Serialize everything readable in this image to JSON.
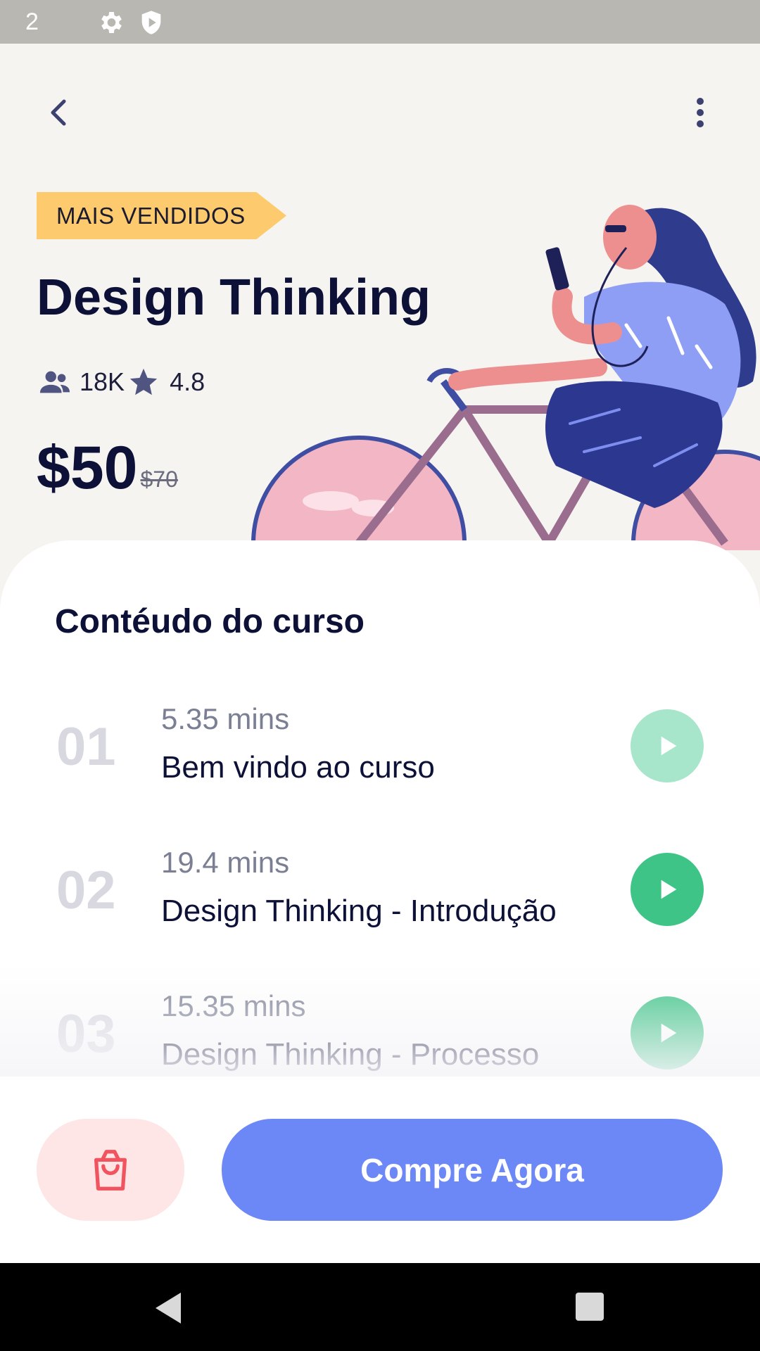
{
  "status_bar": {
    "time": "2",
    "icons": [
      "gear-icon",
      "shield-icon"
    ]
  },
  "header": {
    "back_icon": "chevron-left-icon",
    "menu_icon": "more-vertical-icon"
  },
  "course": {
    "badge": "MAIS VENDIDOS",
    "title": "Design Thinking",
    "students": "18K",
    "rating": "4.8",
    "price": "$50",
    "old_price": "$70"
  },
  "content": {
    "title": "Contéudo do curso",
    "lessons": [
      {
        "number": "01",
        "duration": "5.35 mins",
        "title": "Bem vindo ao curso",
        "state": "faded"
      },
      {
        "number": "02",
        "duration": "19.4 mins",
        "title": "Design Thinking - Introdução",
        "state": "active"
      },
      {
        "number": "03",
        "duration": "15.35 mins",
        "title": "Design Thinking - Processo",
        "state": "active"
      }
    ]
  },
  "actions": {
    "cart_icon": "shopping-bag-icon",
    "buy_label": "Compre Agora"
  },
  "colors": {
    "accent": "#6c87f6",
    "play": "#3ec487",
    "badge": "#fdcb6e",
    "cart_bg": "#fee5e6",
    "cart_icon": "#f0545f"
  }
}
